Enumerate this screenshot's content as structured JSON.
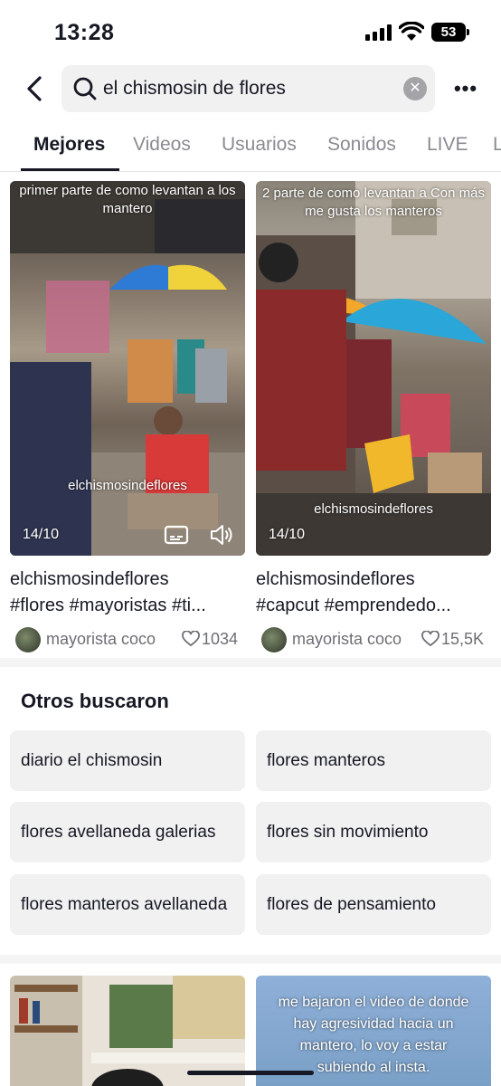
{
  "status_bar": {
    "time": "13:28",
    "battery": "53"
  },
  "search": {
    "query": "el chismosin de flores"
  },
  "tabs": [
    {
      "label": "Mejores"
    },
    {
      "label": "Videos"
    },
    {
      "label": "Usuarios"
    },
    {
      "label": "Sonidos"
    },
    {
      "label": "LIVE"
    },
    {
      "label": "L"
    }
  ],
  "videos": [
    {
      "overlay": "primer parte de como levantan a los mantero",
      "watermark": "elchismosindeflores",
      "date": "14/10",
      "line1": "elchismosindeflores",
      "line2": "#flores #mayoristas #ti...",
      "author": "mayorista coco",
      "likes": "1034"
    },
    {
      "overlay": "2 parte de como levantan a Con más me gusta los manteros",
      "watermark": "elchismosindeflores",
      "date": "14/10",
      "line1": "elchismosindeflores",
      "line2": "#capcut #emprendedo...",
      "author": "mayorista coco",
      "likes": "15,5K"
    }
  ],
  "related": {
    "title": "Otros buscaron",
    "items": [
      "diario el chismosin",
      "flores manteros",
      "flores avellaneda galerias",
      "flores sin movimiento",
      "flores manteros avellaneda",
      "flores de pensamiento"
    ]
  },
  "bottom_videos": [
    {
      "overlay": ""
    },
    {
      "overlay": "me bajaron el video de donde hay agresividad hacia un mantero, lo voy a estar subiendo al insta."
    }
  ]
}
